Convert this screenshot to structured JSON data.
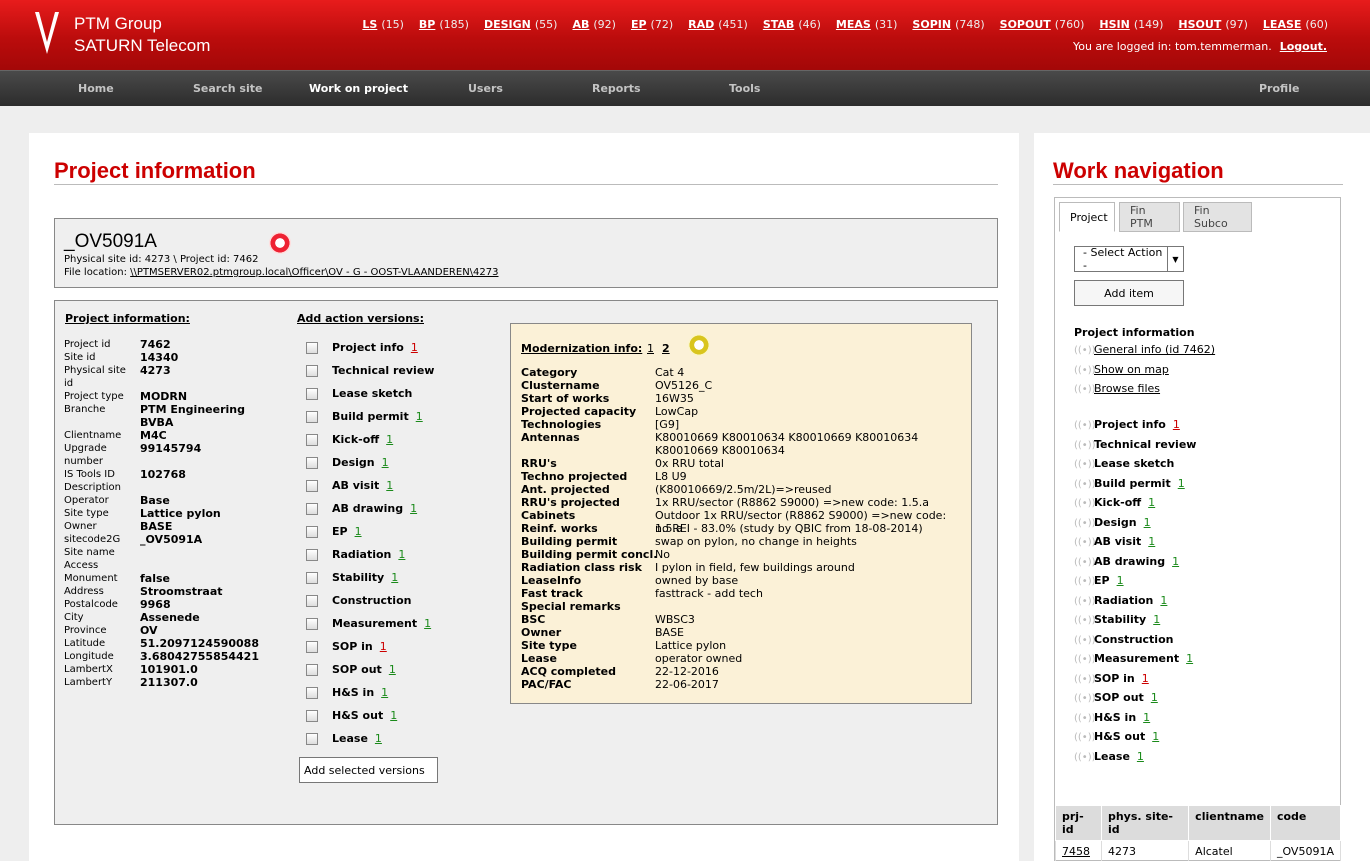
{
  "header": {
    "company": "PTM Group",
    "product": "SATURN Telecom",
    "stats": [
      {
        "label": "LS",
        "count": "(15)"
      },
      {
        "label": "BP",
        "count": "(185)"
      },
      {
        "label": "DESIGN",
        "count": "(55)"
      },
      {
        "label": "AB",
        "count": "(92)"
      },
      {
        "label": "EP",
        "count": "(72)"
      },
      {
        "label": "RAD",
        "count": "(451)"
      },
      {
        "label": "STAB",
        "count": "(46)"
      },
      {
        "label": "MEAS",
        "count": "(31)"
      },
      {
        "label": "SOPIN",
        "count": "(748)"
      },
      {
        "label": "SOPOUT",
        "count": "(760)"
      },
      {
        "label": "HSIN",
        "count": "(149)"
      },
      {
        "label": "HSOUT",
        "count": "(97)"
      },
      {
        "label": "LEASE",
        "count": "(60)"
      }
    ],
    "login_text": "You are logged in: tom.temmerman.",
    "logout": "Logout."
  },
  "nav": [
    "Home",
    "Search site",
    "Work on project",
    "Users",
    "Reports",
    "Tools",
    "Profile"
  ],
  "main": {
    "title": "Project information",
    "project_code": "_OV5091A",
    "ids_line": "Physical site id: 4273 \\ Project id: 7462",
    "file_label": "File location:",
    "file_path": "\\\\PTMSERVER02.ptmgroup.local\\Officer\\OV - G - OOST-VLAANDEREN\\4273",
    "info_title": "Project information:",
    "info": [
      [
        "Project id",
        "7462"
      ],
      [
        "Site id",
        "14340"
      ],
      [
        "Physical site id",
        "4273"
      ],
      [
        "Project type",
        "MODRN"
      ],
      [
        "Branche",
        "PTM Engineering BVBA"
      ],
      [
        "Clientname",
        "M4C"
      ],
      [
        "Upgrade number",
        "99145794"
      ],
      [
        "IS Tools ID",
        "102768"
      ],
      [
        "Description",
        ""
      ],
      [
        "Operator",
        "Base"
      ],
      [
        "Site type",
        "Lattice pylon"
      ],
      [
        "Owner",
        "BASE"
      ],
      [
        "sitecode2G",
        "_OV5091A"
      ],
      [
        "Site name",
        ""
      ],
      [
        "Access",
        ""
      ],
      [
        "Monument",
        "false"
      ],
      [
        "Address",
        "Stroomstraat"
      ],
      [
        "Postalcode",
        "9968"
      ],
      [
        "City",
        "Assenede"
      ],
      [
        "Province",
        "OV"
      ],
      [
        "Latitude",
        "51.2097124590088"
      ],
      [
        "Longitude",
        "3.68042755854421"
      ],
      [
        "LambertX",
        "101901.0"
      ],
      [
        "LambertY",
        "211307.0"
      ]
    ],
    "actions_title": "Add action versions:",
    "actions": [
      [
        "Project info",
        "1",
        "r"
      ],
      [
        "Technical review",
        "",
        ""
      ],
      [
        "Lease sketch",
        "",
        ""
      ],
      [
        "Build permit",
        "1",
        "g"
      ],
      [
        "Kick-off",
        "1",
        "g"
      ],
      [
        "Design",
        "1",
        "g"
      ],
      [
        "AB visit",
        "1",
        "g"
      ],
      [
        "AB drawing",
        "1",
        "g"
      ],
      [
        "EP",
        "1",
        "g"
      ],
      [
        "Radiation",
        "1",
        "g"
      ],
      [
        "Stability",
        "1",
        "g"
      ],
      [
        "Construction",
        "",
        ""
      ],
      [
        "Measurement",
        "1",
        "g"
      ],
      [
        "SOP in",
        "1",
        "r"
      ],
      [
        "SOP out",
        "1",
        "g"
      ],
      [
        "H&S in",
        "1",
        "g"
      ],
      [
        "H&S out",
        "1",
        "g"
      ],
      [
        "Lease",
        "1",
        "g"
      ]
    ],
    "add_versions": "Add selected versions",
    "mod_title": "Modernization info:",
    "mod_links": [
      "1",
      "2"
    ],
    "mod": [
      [
        "Category",
        "Cat 4"
      ],
      [
        "Clustername",
        "OV5126_C"
      ],
      [
        "Start of works",
        "16W35"
      ],
      [
        "Projected capacity",
        "LowCap"
      ],
      [
        "Technologies",
        "[G9]"
      ],
      [
        "Antennas",
        "K80010669 K80010634 K80010669 K80010634 K80010669 K80010634"
      ],
      [
        "RRU's",
        "0x RRU total"
      ],
      [
        "Techno projected",
        "L8 U9"
      ],
      [
        "Ant. projected",
        "(K80010669/2.5m/2L)=>reused"
      ],
      [
        "RRU's projected",
        "1x RRU/sector (R8862 S9000) =>new code: 1.5.a"
      ],
      [
        "Cabinets",
        "Outdoor 1x RRU/sector (R8862 S9000) =>new code: 1.5.a"
      ],
      [
        "Reinf. works",
        "no REI - 83.0% (study by QBIC from 18-08-2014)"
      ],
      [
        "Building permit",
        "swap on pylon, no change in heights"
      ],
      [
        "Building permit concl.",
        "No"
      ],
      [
        "Radiation class risk",
        "I pylon in field, few buildings around"
      ],
      [
        "LeaseInfo",
        "owned by base"
      ],
      [
        "Fast track",
        "fasttrack - add tech"
      ],
      [
        "Special remarks",
        ""
      ],
      [
        "BSC",
        "WBSC3"
      ],
      [
        "Owner",
        "BASE"
      ],
      [
        "Site type",
        "Lattice pylon"
      ],
      [
        "Lease",
        "operator owned"
      ],
      [
        "ACQ completed",
        "22-12-2016"
      ],
      [
        "PAC/FAC",
        "22-06-2017"
      ]
    ]
  },
  "side": {
    "title": "Work navigation",
    "tabs": [
      "Project",
      "Fin PTM",
      "Fin Subco"
    ],
    "select": "- Select Action -",
    "add_item": "Add item",
    "proj_info": "Project information",
    "links": [
      "General info (id 7462)",
      "Show on map",
      "Browse files"
    ],
    "items": [
      [
        "Project info",
        "1",
        "r"
      ],
      [
        "Technical review",
        "",
        ""
      ],
      [
        "Lease sketch",
        "",
        ""
      ],
      [
        "Build permit",
        "1",
        "g"
      ],
      [
        "Kick-off",
        "1",
        "g"
      ],
      [
        "Design",
        "1",
        "g"
      ],
      [
        "AB visit",
        "1",
        "g"
      ],
      [
        "AB drawing",
        "1",
        "g"
      ],
      [
        "EP",
        "1",
        "g"
      ],
      [
        "Radiation",
        "1",
        "g"
      ],
      [
        "Stability",
        "1",
        "g"
      ],
      [
        "Construction",
        "",
        ""
      ],
      [
        "Measurement",
        "1",
        "g"
      ],
      [
        "SOP in",
        "1",
        "r"
      ],
      [
        "SOP out",
        "1",
        "g"
      ],
      [
        "H&S in",
        "1",
        "g"
      ],
      [
        "H&S out",
        "1",
        "g"
      ],
      [
        "Lease",
        "1",
        "g"
      ]
    ],
    "table": {
      "headers": [
        "prj-id",
        "phys. site-id",
        "clientname",
        "code"
      ],
      "rows": [
        [
          "7458",
          "4273",
          "Alcatel",
          "_OV5091A"
        ]
      ]
    }
  },
  "colors": {
    "brand_red": "#c00000",
    "mod_bg": "#fbf1d7"
  }
}
